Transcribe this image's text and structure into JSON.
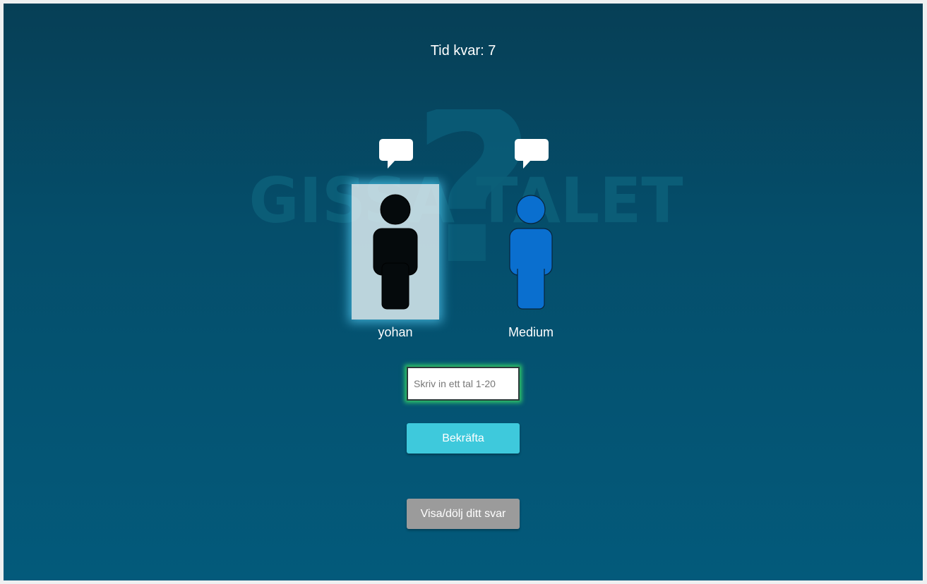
{
  "timer": {
    "label": "Tid kvar:",
    "value": "7"
  },
  "logo": {
    "text": "GISSA TALET",
    "mark": "?"
  },
  "players": [
    {
      "name": "yohan",
      "color": "#050a0c",
      "active": true
    },
    {
      "name": "Medium",
      "color": "#0a6fcf",
      "active": false
    }
  ],
  "guess": {
    "placeholder": "Skriv in ett tal 1-20",
    "value": ""
  },
  "buttons": {
    "confirm": "Bekräfta",
    "toggle_answer": "Visa/dölj ditt svar"
  },
  "colors": {
    "accent": "#3ec9dc",
    "toggle": "#9b9b9b",
    "input_glow": "#3ce664",
    "active_glow": "#50c8f0"
  }
}
